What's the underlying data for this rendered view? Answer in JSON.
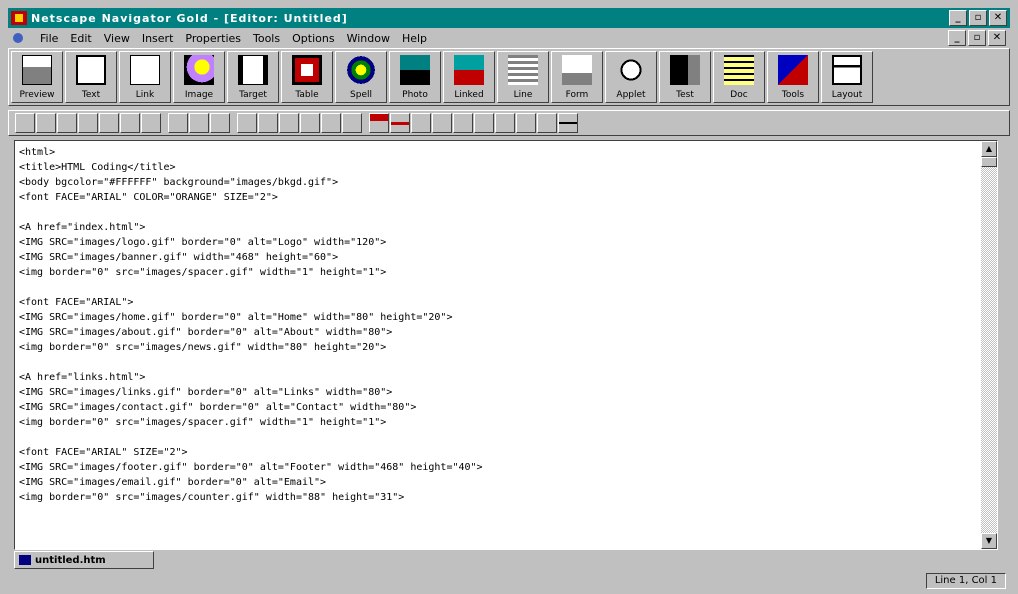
{
  "window": {
    "title": "Netscape Navigator Gold - [Editor: Untitled]"
  },
  "menu": {
    "items": [
      "File",
      "Edit",
      "View",
      "Insert",
      "Properties",
      "Tools",
      "Options",
      "Window",
      "Help"
    ]
  },
  "toolbar": {
    "buttons": [
      {
        "label": "Preview",
        "icon": "preview-icon"
      },
      {
        "label": "Text",
        "icon": "text-icon"
      },
      {
        "label": "Link",
        "icon": "link-icon"
      },
      {
        "label": "Image",
        "icon": "image-icon"
      },
      {
        "label": "Target",
        "icon": "target-icon"
      },
      {
        "label": "Table",
        "icon": "table-icon"
      },
      {
        "label": "Spell",
        "icon": "spell-icon"
      },
      {
        "label": "Photo",
        "icon": "photo-icon"
      },
      {
        "label": "Linked",
        "icon": "linked-icon"
      },
      {
        "label": "Line",
        "icon": "line-icon"
      },
      {
        "label": "Form",
        "icon": "form-icon"
      },
      {
        "label": "Applet",
        "icon": "applet-icon"
      },
      {
        "label": "Test",
        "icon": "test-icon"
      },
      {
        "label": "Doc",
        "icon": "doc-icon"
      },
      {
        "label": "Tools",
        "icon": "tools-icon"
      },
      {
        "label": "Layout",
        "icon": "layout-icon"
      }
    ]
  },
  "format_toolbar": {
    "buttons": [
      "new",
      "open",
      "save",
      "print",
      "cut",
      "copy",
      "paste",
      "bold",
      "italic",
      "underline",
      "h1",
      "h2",
      "h3",
      "h4",
      "h5",
      "h6",
      "text-color",
      "hr",
      "indent",
      "align-left",
      "align-center",
      "align-right",
      "list",
      "image",
      "table",
      "rule"
    ]
  },
  "editor": {
    "lines": [
      "<html>",
      "<title>HTML Coding</title>",
      "<body bgcolor=\"#FFFFFF\" background=\"images/bkgd.gif\">",
      "<font FACE=\"ARIAL\" COLOR=\"ORANGE\" SIZE=\"2\">",
      "",
      "<A href=\"index.html\">",
      "<IMG SRC=\"images/logo.gif\" border=\"0\" alt=\"Logo\" width=\"120\">",
      "<IMG SRC=\"images/banner.gif\" width=\"468\" height=\"60\">",
      "<img border=\"0\" src=\"images/spacer.gif\" width=\"1\" height=\"1\">",
      "",
      "<font FACE=\"ARIAL\">",
      "<IMG SRC=\"images/home.gif\" border=\"0\" alt=\"Home\" width=\"80\" height=\"20\">",
      "<IMG SRC=\"images/about.gif\" border=\"0\" alt=\"About\" width=\"80\">",
      "<img border=\"0\" src=\"images/news.gif\" width=\"80\" height=\"20\">",
      "",
      "<A href=\"links.html\">",
      "<IMG SRC=\"images/links.gif\" border=\"0\" alt=\"Links\" width=\"80\">",
      "<IMG SRC=\"images/contact.gif\" border=\"0\" alt=\"Contact\" width=\"80\">",
      "<img border=\"0\" src=\"images/spacer.gif\" width=\"1\" height=\"1\">",
      "",
      "<font FACE=\"ARIAL\" SIZE=\"2\">",
      "<IMG SRC=\"images/footer.gif\" border=\"0\" alt=\"Footer\" width=\"468\" height=\"40\">",
      "<IMG SRC=\"images/email.gif\" border=\"0\" alt=\"Email\">",
      "<img border=\"0\" src=\"images/counter.gif\" width=\"88\" height=\"31\">"
    ]
  },
  "doc_tab": {
    "label": "untitled.htm"
  },
  "status": {
    "position": "Line 1, Col 1"
  },
  "colors": {
    "titlebar": "#008080",
    "face": "#c0c0c0",
    "editor_bg": "#ffffff"
  }
}
